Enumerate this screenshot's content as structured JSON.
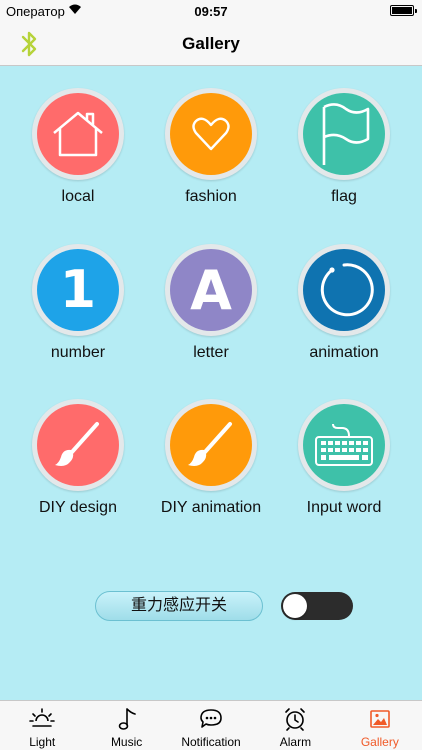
{
  "status_bar": {
    "carrier": "Оператор",
    "time": "09:57"
  },
  "nav": {
    "title": "Gallery",
    "left_icon": "bluetooth-icon"
  },
  "tiles": [
    {
      "label": "local",
      "color": "#ff6b6b",
      "icon": "house-icon"
    },
    {
      "label": "fashion",
      "color": "#ff9a0a",
      "icon": "heart-icon"
    },
    {
      "label": "flag",
      "color": "#3ec1a9",
      "icon": "flag-icon"
    },
    {
      "label": "number",
      "color": "#1ea3e8",
      "icon": "number-one-icon",
      "glyph": "1"
    },
    {
      "label": "letter",
      "color": "#8f86c7",
      "icon": "letter-a-icon",
      "glyph": "A"
    },
    {
      "label": "animation",
      "color": "#0f73b0",
      "icon": "circle-arc-icon"
    },
    {
      "label": "DIY design",
      "color": "#ff6b6b",
      "icon": "brush-icon"
    },
    {
      "label": "DIY animation",
      "color": "#ff9a0a",
      "icon": "brush-icon"
    },
    {
      "label": "Input word",
      "color": "#3ec1a9",
      "icon": "keyboard-icon"
    }
  ],
  "gravity": {
    "label": "重力感应开关",
    "switch_on": false
  },
  "tabs": [
    {
      "label": "Light",
      "icon": "sun-icon",
      "active": false
    },
    {
      "label": "Music",
      "icon": "music-note-icon",
      "active": false
    },
    {
      "label": "Notification",
      "icon": "chat-bubble-icon",
      "active": false
    },
    {
      "label": "Alarm",
      "icon": "alarm-clock-icon",
      "active": false
    },
    {
      "label": "Gallery",
      "icon": "picture-icon",
      "active": true
    }
  ],
  "colors": {
    "accent": "#f05a28",
    "content_bg": "#b5ecf4",
    "bluetooth": "#b6d33a"
  }
}
